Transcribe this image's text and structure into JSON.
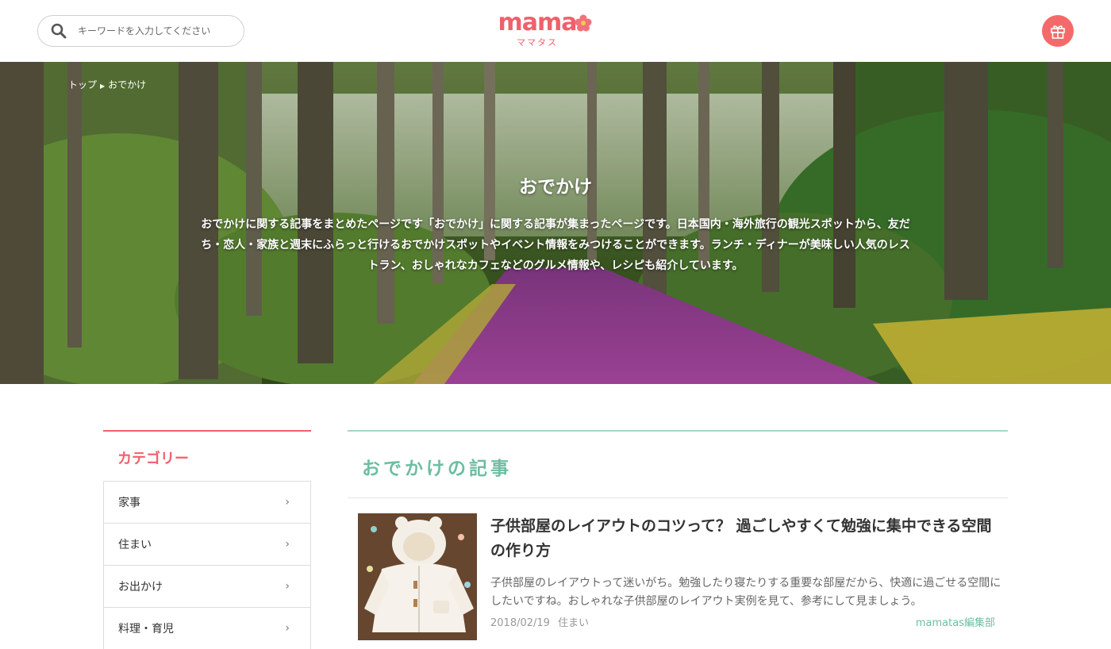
{
  "header": {
    "search_placeholder": "キーワードを入力してください",
    "logo_text": "mama",
    "logo_sub": "ママタス"
  },
  "hero": {
    "breadcrumb": [
      "トップ",
      "おでかけ"
    ],
    "title": "おでかけ",
    "description": "おでかけに関する記事をまとめたページです「おでかけ」に関する記事が集まったページです。日本国内・海外旅行の観光スポットから、友だち・恋人・家族と週末にふらっと行けるおでかけスポットやイベント情報をみつけることができます。ランチ・ディナーが美味しい人気のレストラン、おしゃれなカフェなどのグルメ情報や、レシピも紹介しています。"
  },
  "sidebar": {
    "heading": "カテゴリー",
    "items": [
      {
        "label": "家事"
      },
      {
        "label": "住まい"
      },
      {
        "label": "お出かけ"
      },
      {
        "label": "料理・育児"
      }
    ]
  },
  "main": {
    "heading": "おでかけの記事",
    "articles": [
      {
        "title": "子供部屋のレイアウトのコツって？ 過ごしやすくて勉強に集中できる空間の作り方",
        "excerpt": "子供部屋のレイアウトって迷いがち。勉強したり寝たりする重要な部屋だから、快適に過ごせる空間にしたいですね。おしゃれな子供部屋のレイアウト実例を見て、参考にして見ましょう。",
        "date": "2018/02/19",
        "category": "住まい",
        "author": "mamatas編集部"
      }
    ]
  },
  "colors": {
    "brand": "#f0606b",
    "accent": "#6dbea3"
  }
}
